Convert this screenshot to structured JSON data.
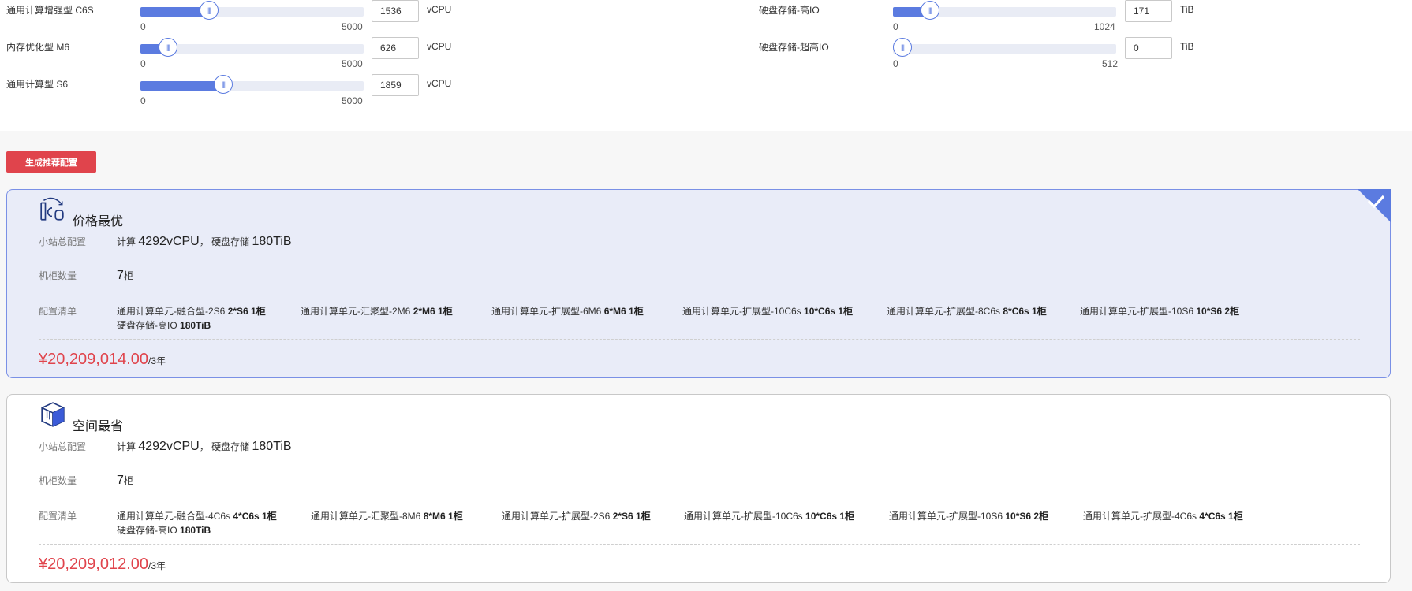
{
  "sliders": {
    "c6s": {
      "label": "通用计算增强型 C6S",
      "min": "0",
      "max": "5000",
      "value": "1536",
      "unit": "vCPU",
      "level": 0.3072
    },
    "m6": {
      "label": "内存优化型 M6",
      "min": "0",
      "max": "5000",
      "value": "626",
      "unit": "vCPU",
      "level": 0.1252
    },
    "s6": {
      "label": "通用计算型 S6",
      "min": "0",
      "max": "5000",
      "value": "1859",
      "unit": "vCPU",
      "level": 0.3718
    },
    "high_io": {
      "label": "硬盘存储-高IO",
      "min": "0",
      "max": "1024",
      "value": "171",
      "unit": "TiB",
      "level": 0.167
    },
    "ultra_io": {
      "label": "硬盘存储-超高IO",
      "min": "0",
      "max": "512",
      "value": "0",
      "unit": "TiB",
      "level": 0
    }
  },
  "thumb_glyph": "|||",
  "generate_button": "生成推荐配置",
  "plans": [
    {
      "title": "价格最优",
      "icon": "price-optimal-icon",
      "selected": true,
      "total_label": "小站总配置",
      "compute_label": "计算",
      "compute_value": "4292vCPU",
      "sep": "，",
      "storage_label": "硬盘存储",
      "storage_value": "180TiB",
      "rack_label": "机柜数量",
      "rack_value": "7",
      "rack_unit": "柜",
      "list_label": "配置清单",
      "items": [
        {
          "name": "通用计算单元-融合型-2S6",
          "qty": "2*S6 1柜"
        },
        {
          "name": "通用计算单元-汇聚型-2M6",
          "qty": "2*M6 1柜"
        },
        {
          "name": "通用计算单元-扩展型-6M6",
          "qty": "6*M6 1柜"
        },
        {
          "name": "通用计算单元-扩展型-10C6s",
          "qty": "10*C6s 1柜"
        },
        {
          "name": "通用计算单元-扩展型-8C6s",
          "qty": "8*C6s 1柜"
        },
        {
          "name": "通用计算单元-扩展型-10S6",
          "qty": "10*S6 2柜"
        },
        {
          "name": "硬盘存储-高IO",
          "qty": "180TiB"
        }
      ],
      "price": "¥20,209,014.00",
      "price_unit": "/3年"
    },
    {
      "title": "空间最省",
      "icon": "space-saving-cube-icon",
      "selected": false,
      "total_label": "小站总配置",
      "compute_label": "计算",
      "compute_value": "4292vCPU",
      "sep": "，",
      "storage_label": "硬盘存储",
      "storage_value": "180TiB",
      "rack_label": "机柜数量",
      "rack_value": "7",
      "rack_unit": "柜",
      "list_label": "配置清单",
      "items": [
        {
          "name": "通用计算单元-融合型-4C6s",
          "qty": "4*C6s 1柜"
        },
        {
          "name": "通用计算单元-汇聚型-8M6",
          "qty": "8*M6 1柜"
        },
        {
          "name": "通用计算单元-扩展型-2S6",
          "qty": "2*S6 1柜"
        },
        {
          "name": "通用计算单元-扩展型-10C6s",
          "qty": "10*C6s 1柜"
        },
        {
          "name": "通用计算单元-扩展型-10S6",
          "qty": "10*S6 2柜"
        },
        {
          "name": "通用计算单元-扩展型-4C6s",
          "qty": "4*C6s 1柜"
        },
        {
          "name": "硬盘存储-高IO",
          "qty": "180TiB"
        }
      ],
      "price": "¥20,209,012.00",
      "price_unit": "/3年"
    }
  ],
  "colors": {
    "accent": "#5b7be0",
    "danger": "#e0444c",
    "selected_bg": "#e9ecf8"
  }
}
